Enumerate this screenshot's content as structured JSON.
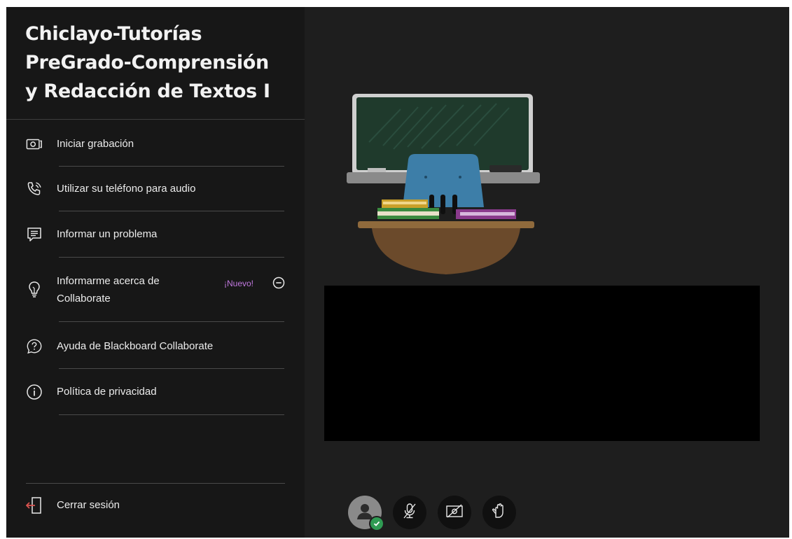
{
  "session": {
    "title_lines": [
      "Chiclayo-Tutorías",
      "PreGrado-Comprensión",
      "y Redacción de Textos I"
    ]
  },
  "menu": {
    "start_recording": "Iniciar grabación",
    "phone_audio": "Utilizar su teléfono para audio",
    "report_problem": "Informar un problema",
    "learn_about_1": "Informarme acerca de",
    "learn_about_2": "Collaborate",
    "new_badge": "¡Nuevo!",
    "help": "Ayuda de Blackboard Collaborate",
    "privacy": "Política de privacidad",
    "logout": "Cerrar sesión"
  },
  "icons": {
    "record": "record-icon",
    "phone": "phone-icon",
    "report": "report-icon",
    "lightbulb": "lightbulb-icon",
    "help": "help-icon",
    "info": "info-icon",
    "logout": "logout-icon",
    "mic_off": "microphone-off-icon",
    "camera_off": "camera-off-icon",
    "raise_hand": "raise-hand-icon"
  },
  "colors": {
    "accent_new": "#c279e0",
    "status_ok": "#2f9b53",
    "logout_arrow": "#d9534f"
  }
}
